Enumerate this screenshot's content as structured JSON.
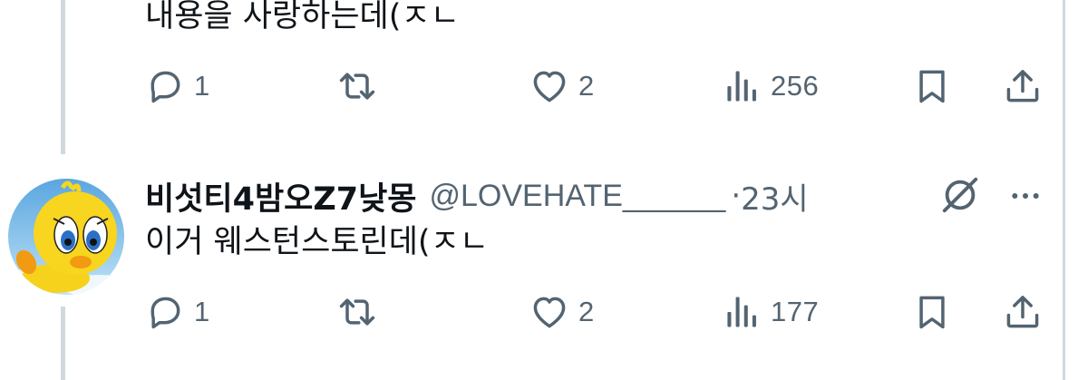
{
  "tweet1": {
    "text_tail": "내용을 사랑하는데(ㅈㄴ",
    "actions": {
      "reply": {
        "icon": "reply-icon",
        "count": "1"
      },
      "retweet": {
        "icon": "retweet-icon",
        "count": ""
      },
      "like": {
        "icon": "heart-icon",
        "count": "2"
      },
      "views": {
        "icon": "views-icon",
        "count": "256"
      },
      "bookmark": {
        "icon": "bookmark-icon"
      },
      "share": {
        "icon": "share-icon"
      }
    }
  },
  "tweet2": {
    "display_name": "비섯티4밤오Z7낮몽",
    "handle": "@LOVEHATE______",
    "separator": "·",
    "time": "23시",
    "text": "이거 웨스턴스토린데(ㅈㄴ",
    "avatar": "tweety-bird-avatar",
    "actions": {
      "reply": {
        "icon": "reply-icon",
        "count": "1"
      },
      "retweet": {
        "icon": "retweet-icon",
        "count": ""
      },
      "like": {
        "icon": "heart-icon",
        "count": "2"
      },
      "views": {
        "icon": "views-icon",
        "count": "177"
      },
      "bookmark": {
        "icon": "bookmark-icon"
      },
      "share": {
        "icon": "share-icon"
      }
    }
  },
  "colors": {
    "text_primary": "#0f1419",
    "text_secondary": "#536471",
    "thread_line": "#cfd9de"
  }
}
